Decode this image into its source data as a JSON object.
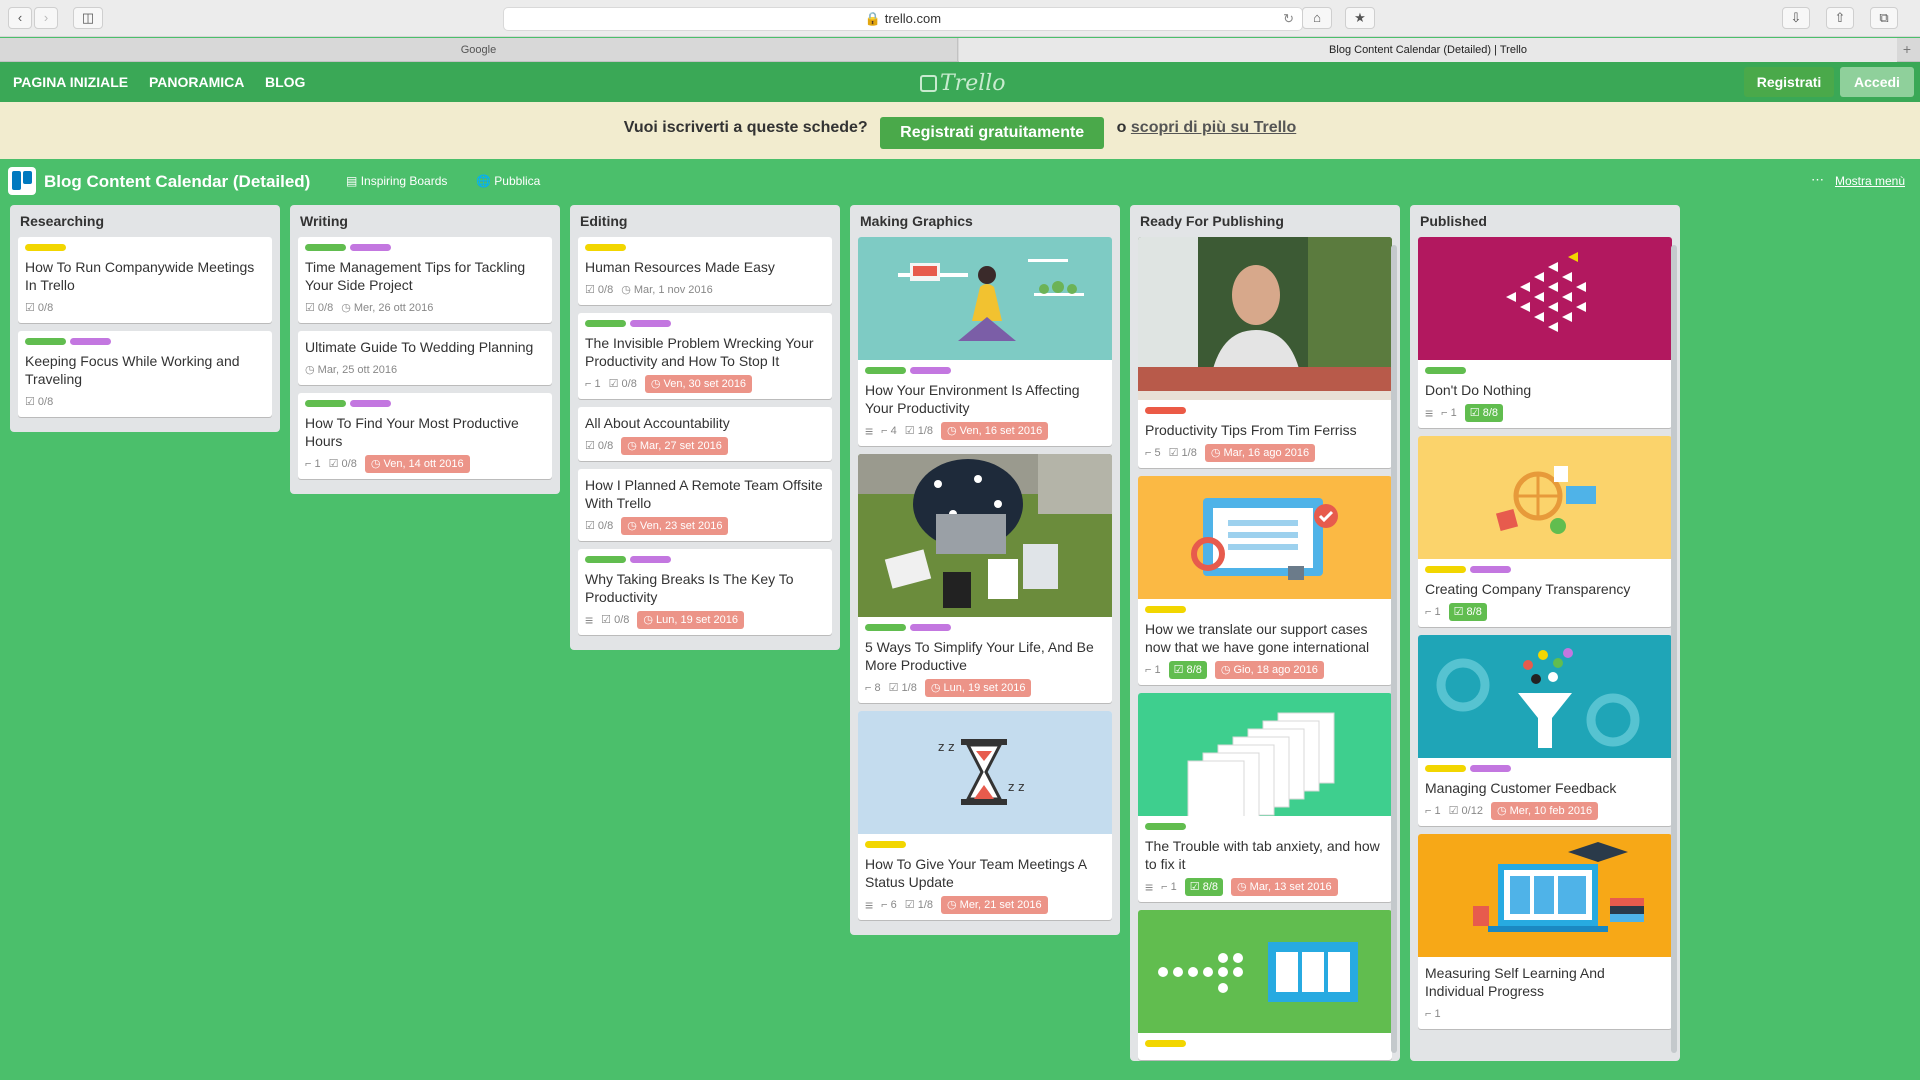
{
  "browser": {
    "url": "trello.com",
    "tabs": [
      "Google",
      "Blog Content Calendar (Detailed) | Trello"
    ]
  },
  "nav": {
    "links": [
      "PAGINA INIZIALE",
      "PANORAMICA",
      "BLOG"
    ],
    "logo": "Trello",
    "signup": "Registrati",
    "login": "Accedi"
  },
  "promo": {
    "text": "Vuoi iscriverti a queste schede?",
    "button": "Registrati gratuitamente",
    "or": "o",
    "link": "scopri di più su Trello"
  },
  "board": {
    "title": "Blog Content Calendar (Detailed)",
    "team": "Inspiring Boards",
    "visibility": "Pubblica",
    "menu": "Mostra menù"
  },
  "colors": {
    "green": "#61bd4f",
    "yellow": "#f2d600",
    "purple": "#c377e0",
    "red": "#eb5a46",
    "due": "#ec9488"
  },
  "lists": [
    {
      "name": "Researching",
      "cards": [
        {
          "labels": [
            "yellow"
          ],
          "title": "How To Run Companywide Meetings In Trello",
          "checklist": "0/8"
        },
        {
          "labels": [
            "green",
            "purple"
          ],
          "title": "Keeping Focus While Working and Traveling",
          "checklist": "0/8"
        }
      ]
    },
    {
      "name": "Writing",
      "cards": [
        {
          "labels": [
            "green",
            "purple"
          ],
          "title": "Time Management Tips for Tackling Your Side Project",
          "checklist": "0/8",
          "date": "Mer, 26 ott 2016"
        },
        {
          "labels": [],
          "title": "Ultimate Guide To Wedding Planning",
          "date": "Mar, 25 ott 2016"
        },
        {
          "labels": [
            "green",
            "purple"
          ],
          "title": "How To Find Your Most Productive Hours",
          "attachments": "1",
          "checklist": "0/8",
          "due": "Ven, 14 ott 2016"
        }
      ]
    },
    {
      "name": "Editing",
      "cards": [
        {
          "labels": [
            "yellow"
          ],
          "title": "Human Resources Made Easy",
          "checklist": "0/8",
          "date": "Mar, 1 nov 2016"
        },
        {
          "labels": [
            "green",
            "purple"
          ],
          "title": "The Invisible Problem Wrecking Your Productivity and How To Stop It",
          "attachments": "1",
          "checklist": "0/8",
          "due": "Ven, 30 set 2016"
        },
        {
          "labels": [],
          "title": "All About Accountability",
          "checklist": "0/8",
          "due": "Mar, 27 set 2016"
        },
        {
          "labels": [],
          "title": "How I Planned A Remote Team Offsite With Trello",
          "checklist": "0/8",
          "due": "Ven, 23 set 2016"
        },
        {
          "labels": [
            "green",
            "purple"
          ],
          "title": "Why Taking Breaks Is The Key To Productivity",
          "description": "true",
          "checklist": "0/8",
          "due": "Lun, 19 set 2016"
        }
      ]
    },
    {
      "name": "Making Graphics",
      "cards": [
        {
          "cover": "meditation-desk-illustration",
          "labels": [
            "green",
            "purple"
          ],
          "title": "How Your Environment Is Affecting Your Productivity",
          "description": "true",
          "attachments": "4",
          "checklist": "1/8",
          "due": "Ven, 16 set 2016"
        },
        {
          "cover": "laptop-on-grass-photo",
          "labels": [
            "green",
            "purple"
          ],
          "title": "5 Ways To Simplify Your Life, And Be More Productive",
          "attachments": "8",
          "checklist": "1/8",
          "due": "Lun, 19 set 2016"
        },
        {
          "cover": "hourglass-illustration",
          "labels": [
            "yellow"
          ],
          "title": "How To Give Your Team Meetings A Status Update",
          "description": "true",
          "attachments": "6",
          "checklist": "1/8",
          "due": "Mer, 21 set 2016"
        }
      ]
    },
    {
      "name": "Ready For Publishing",
      "cards": [
        {
          "cover": "man-portrait-photo",
          "labels": [
            "red"
          ],
          "title": "Productivity Tips From Tim Ferriss",
          "attachments": "5",
          "checklist": "1/8",
          "due": "Mar, 16 ago 2016"
        },
        {
          "cover": "support-computer-illustration",
          "labels": [
            "yellow"
          ],
          "title": "How we translate our support cases now that we have gone international",
          "attachments": "1",
          "checklist_done": "8/8",
          "due": "Gio, 18 ago 2016"
        },
        {
          "cover": "tabs-stack-illustration",
          "labels": [
            "green"
          ],
          "title": "The Trouble with tab anxiety, and how to fix it",
          "description": "true",
          "attachments": "1",
          "checklist_done": "8/8",
          "due": "Mar, 13 set 2016"
        },
        {
          "cover": "board-people-illustration",
          "labels": [
            "yellow"
          ],
          "title": ""
        }
      ]
    },
    {
      "name": "Published",
      "cards": [
        {
          "cover": "fish-school-illustration",
          "labels": [
            "green"
          ],
          "title": "Don't Do Nothing",
          "description": "true",
          "attachments": "1",
          "checklist_done": "8/8"
        },
        {
          "cover": "transparency-illustration",
          "labels": [
            "yellow",
            "purple"
          ],
          "title": "Creating Company Transparency",
          "attachments": "1",
          "checklist_done": "8/8"
        },
        {
          "cover": "feedback-funnel-illustration",
          "labels": [
            "yellow",
            "purple"
          ],
          "title": "Managing Customer Feedback",
          "attachments": "1",
          "checklist": "0/12",
          "due": "Mer, 10 feb 2016"
        },
        {
          "cover": "learning-laptop-illustration",
          "labels": [],
          "title": "Measuring Self Learning And Individual Progress",
          "attachments": "1"
        }
      ]
    }
  ]
}
